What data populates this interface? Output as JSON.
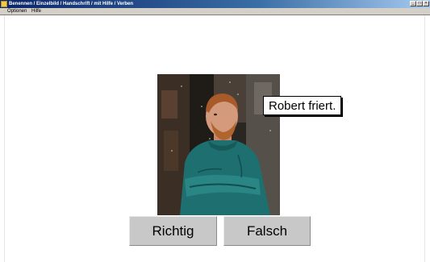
{
  "window": {
    "title": "Benennen / Einzelbild / Handschrift / mit Hilfe / Verben",
    "controls": {
      "minimize": "_",
      "maximize": "□",
      "close": "×"
    }
  },
  "menu": {
    "items": [
      {
        "label": "Optionen"
      },
      {
        "label": "Hilfe"
      }
    ]
  },
  "exercise": {
    "caption": "Robert friert.",
    "buttons": {
      "correct": "Richtig",
      "wrong": "Falsch"
    }
  },
  "colors": {
    "titlebar_start": "#0a246a",
    "titlebar_end": "#a6caf0",
    "button_face": "#c8c8c8",
    "sweater": "#1e6f6f"
  }
}
